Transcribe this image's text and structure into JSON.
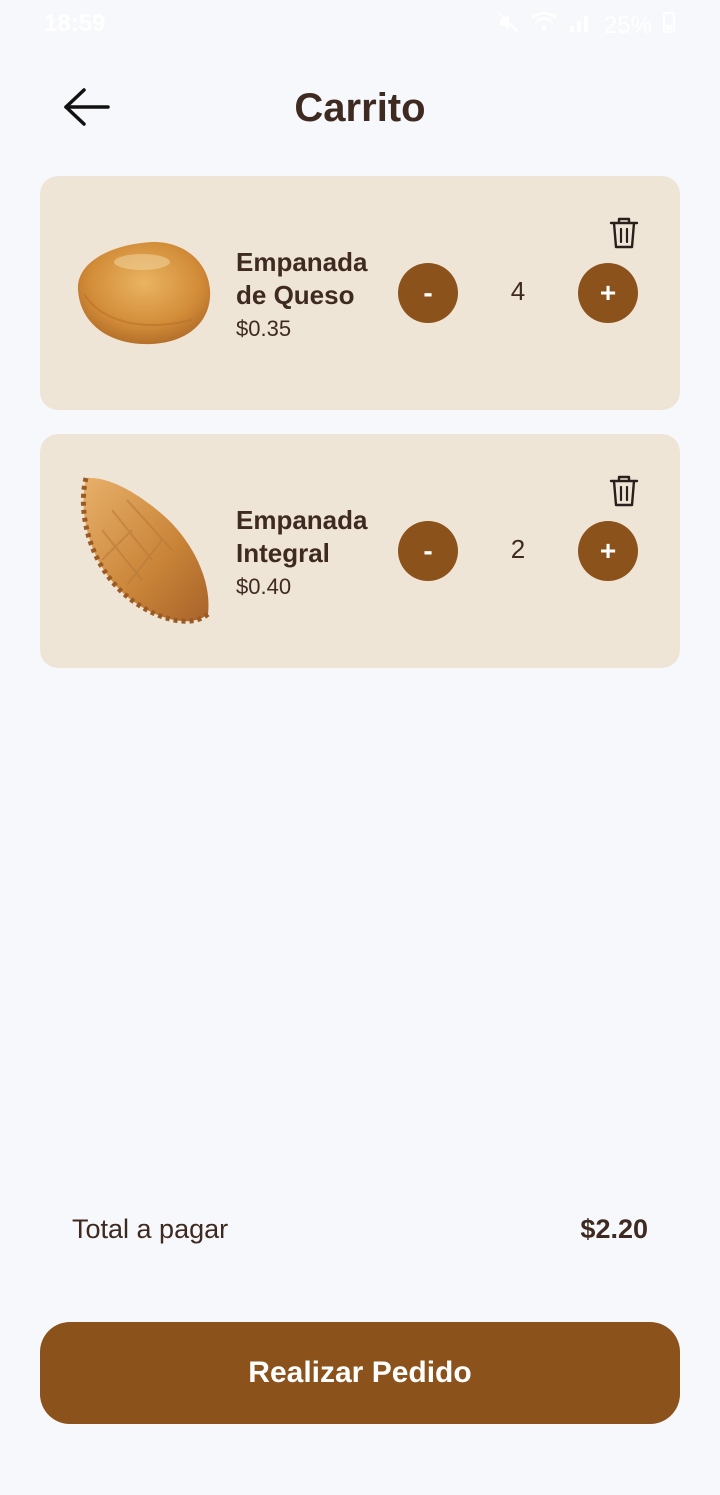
{
  "status_bar": {
    "time": "18:59",
    "battery": "25%"
  },
  "header": {
    "title": "Carrito",
    "back_icon": "arrow-left-icon"
  },
  "cart": {
    "items": [
      {
        "name": "Empanada de Queso",
        "price": "$0.35",
        "quantity": "4",
        "minus_label": "-",
        "plus_label": "+"
      },
      {
        "name": "Empanada Integral",
        "price": "$0.40",
        "quantity": "2",
        "minus_label": "-",
        "plus_label": "+"
      }
    ]
  },
  "summary": {
    "total_label": "Total a pagar",
    "total_value": "$2.20"
  },
  "actions": {
    "order_label": "Realizar Pedido"
  },
  "colors": {
    "accent": "#8b521c",
    "card": "#efe5d7",
    "text": "#3e2a20",
    "background": "#f7f8fb"
  }
}
